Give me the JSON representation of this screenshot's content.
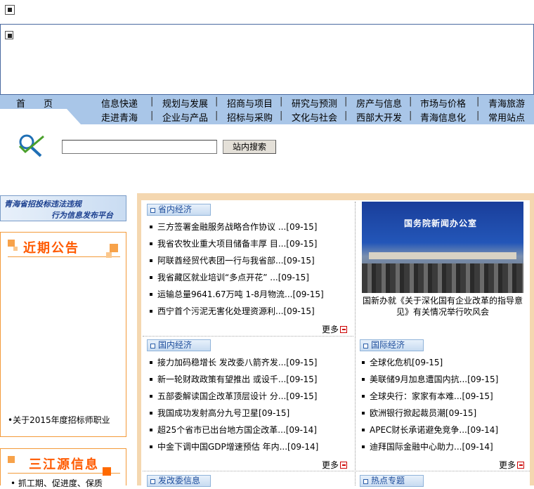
{
  "nav": {
    "row1": [
      "首　　页",
      "信息快递",
      "规划与发展",
      "招商与项目",
      "研究与预测",
      "房产与信息",
      "市场与价格",
      "青海旅游"
    ],
    "row2": [
      "走进青海",
      "企业与产品",
      "招标与采购",
      "文化与社会",
      "西部大开发",
      "青海信息化",
      "常用站点"
    ],
    "separator": "|"
  },
  "search": {
    "value": "",
    "button_label": "站内搜索"
  },
  "left": {
    "banner_line1": "青海省招投标违法违规",
    "banner_line2": "行为信息发布平台",
    "notice_title": "近期公告",
    "notice_item": "•关于2015年度招标师职业",
    "sanjiangyuan_title": "三江源信息",
    "sanjiangyuan_item": "• 抓工期、促进度、保质"
  },
  "sections": {
    "provincial": {
      "title": "省内经济",
      "items": [
        "三方签署金融服务战略合作协议 ...[09-15]",
        "我省农牧业重大项目储备丰厚  目...[09-15]",
        "阿联酋经贸代表团一行与我省部...[09-15]",
        "我省藏区就业培训“多点开花” ...[09-15]",
        "运输总量9641.67万吨 1-8月物流...[09-15]",
        "西宁首个污泥无害化处理资源利...[09-15]"
      ],
      "more": "更多"
    },
    "domestic": {
      "title": "国内经济",
      "items": [
        "接力加码稳增长 发改委八箭齐发...[09-15]",
        "新一轮财政政策有望推出 或设千...[09-15]",
        "五部委解读国企改革顶层设计 分...[09-15]",
        "我国成功发射高分九号卫星[09-15]",
        "超25个省市已出台地方国企改革...[09-14]",
        "中金下调中国GDP增速预估 年内...[09-14]"
      ],
      "more": "更多"
    },
    "international": {
      "title": "国际经济",
      "items": [
        "全球化危机[09-15]",
        "美联储9月加息遭国内抗...[09-15]",
        "全球央行：家家有本难...[09-15]",
        "欧洲银行掀起裁员潮[09-15]",
        "APEC财长承诺避免竞争...[09-14]",
        "迪拜国际金融中心助力...[09-14]"
      ],
      "more": "更多"
    },
    "ndrc": {
      "title": "发改委信息"
    },
    "hot": {
      "title": "热点专题"
    }
  },
  "photo": {
    "sign_text": "国务院新闻办公室",
    "caption": "国新办就《关于深化国有企业改革的指导意见》有关情况举行吹风会"
  },
  "colors": {
    "nav_bg": "#a9c6e8",
    "accent_orange": "#ff5a00",
    "section_blue": "#1e4e9c",
    "main_frame": "#f4d7b0"
  }
}
